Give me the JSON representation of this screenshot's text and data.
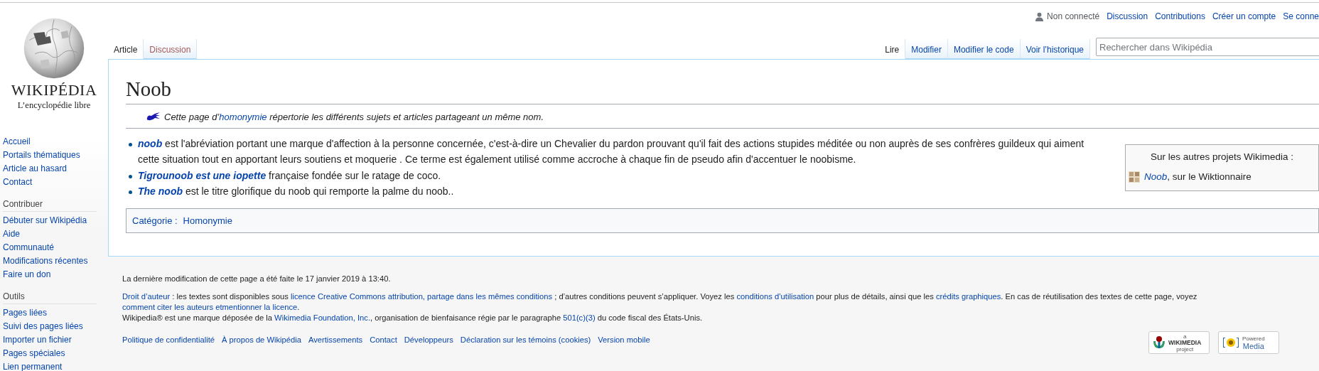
{
  "logo": {
    "wordmark": "WIKIPÉDIA",
    "tagline": "L’encyclopédie libre"
  },
  "personal": {
    "status": "Non connecté",
    "links": [
      "Discussion",
      "Contributions",
      "Créer un compte",
      "Se conne"
    ]
  },
  "left_tabs": [
    {
      "label": "Article",
      "selected": true,
      "missing": false
    },
    {
      "label": "Discussion",
      "selected": false,
      "missing": true
    }
  ],
  "right_tabs": [
    {
      "label": "Lire",
      "selected": true
    },
    {
      "label": "Modifier",
      "selected": false
    },
    {
      "label": "Modifier le code",
      "selected": false
    },
    {
      "label": "Voir l’historique",
      "selected": false
    }
  ],
  "search": {
    "placeholder": "Rechercher dans Wikipédia"
  },
  "sidebar": [
    {
      "items": [
        "Accueil",
        "Portails thématiques",
        "Article au hasard",
        "Contact"
      ]
    },
    {
      "heading": "Contribuer",
      "items": [
        "Débuter sur Wikipédia",
        "Aide",
        "Communauté",
        "Modifications récentes",
        "Faire un don"
      ]
    },
    {
      "heading": "Outils",
      "items": [
        "Pages liées",
        "Suivi des pages liées",
        "Importer un fichier",
        "Pages spéciales",
        "Lien permanent"
      ]
    }
  ],
  "title": "Noob",
  "hatnote": {
    "before": "Cette page d’",
    "link": "homonymie",
    "after": " répertorie les différents sujets et articles partageant un même nom."
  },
  "sister_box": {
    "title": "Sur les autres projets Wikimedia :",
    "link": "Noob",
    "after": ", sur le Wiktionnaire"
  },
  "entries": [
    {
      "link": "noob",
      "text": "est l'abréviation portant une marque d'affection à la personne concernée, c'est-à-dire un Chevalier du pardon prouvant qu'il fait des actions stupides méditée ou non auprès de ses confrères guildeux qui aiment cette situation tout en apportant leurs soutiens et moquerie . Ce terme est également utilisé comme accroche à chaque fin de pseudo afin d'accentuer le noobisme."
    },
    {
      "link": "Tigrounoob est une iopette",
      "text": "française fondée sur le ratage de coco."
    },
    {
      "link": "The noob",
      "text": "est le titre glorifique du noob qui remporte la palme du noob.."
    }
  ],
  "categories": {
    "label": "Catégorie :",
    "items": [
      "Homonymie"
    ]
  },
  "footer": {
    "last_modified": "La dernière modification de cette page a été faite le 17 janvier 2019 à 13:40.",
    "license": [
      {
        "text": "Droit d’auteur",
        "kind": "link"
      },
      {
        "text": " : les textes sont disponibles sous ",
        "kind": "text"
      },
      {
        "text": "licence Creative Commons attribution, partage dans les mêmes conditions",
        "kind": "link"
      },
      {
        "text": " ; d’autres conditions peuvent s’appliquer. Voyez les ",
        "kind": "text"
      },
      {
        "text": "conditions d’utilisation",
        "kind": "link"
      },
      {
        "text": " pour plus de détails, ainsi que les ",
        "kind": "text"
      },
      {
        "text": "crédits graphiques",
        "kind": "link"
      },
      {
        "text": ". En cas de réutilisation des textes de cette page, voyez ",
        "kind": "text"
      },
      {
        "text": "comment citer les auteurs et",
        "kind": "link"
      },
      {
        "text": "mentionner la licence",
        "kind": "link"
      },
      {
        "text": ".",
        "kind": "text"
      }
    ],
    "trademark": [
      {
        "text": "Wikipedia® est une marque déposée de la ",
        "kind": "text"
      },
      {
        "text": "Wikimedia Foundation, Inc.",
        "kind": "link"
      },
      {
        "text": ", organisation de bienfaisance régie par le paragraphe ",
        "kind": "text"
      },
      {
        "text": "501(c)(3)",
        "kind": "link"
      },
      {
        "text": " du code fiscal des États-Unis.",
        "kind": "text"
      }
    ],
    "links": [
      "Politique de confidentialité",
      "À propos de Wikipédia",
      "Avertissements",
      "Contact",
      "Développeurs",
      "Déclaration sur les témoins (cookies)",
      "Version mobile"
    ],
    "badges": [
      {
        "kind": "wikimedia",
        "small": "a",
        "big": "WIKIMEDIA",
        "sub": "project"
      },
      {
        "kind": "mediawiki",
        "small": "Powered",
        "big": "Media"
      }
    ]
  }
}
